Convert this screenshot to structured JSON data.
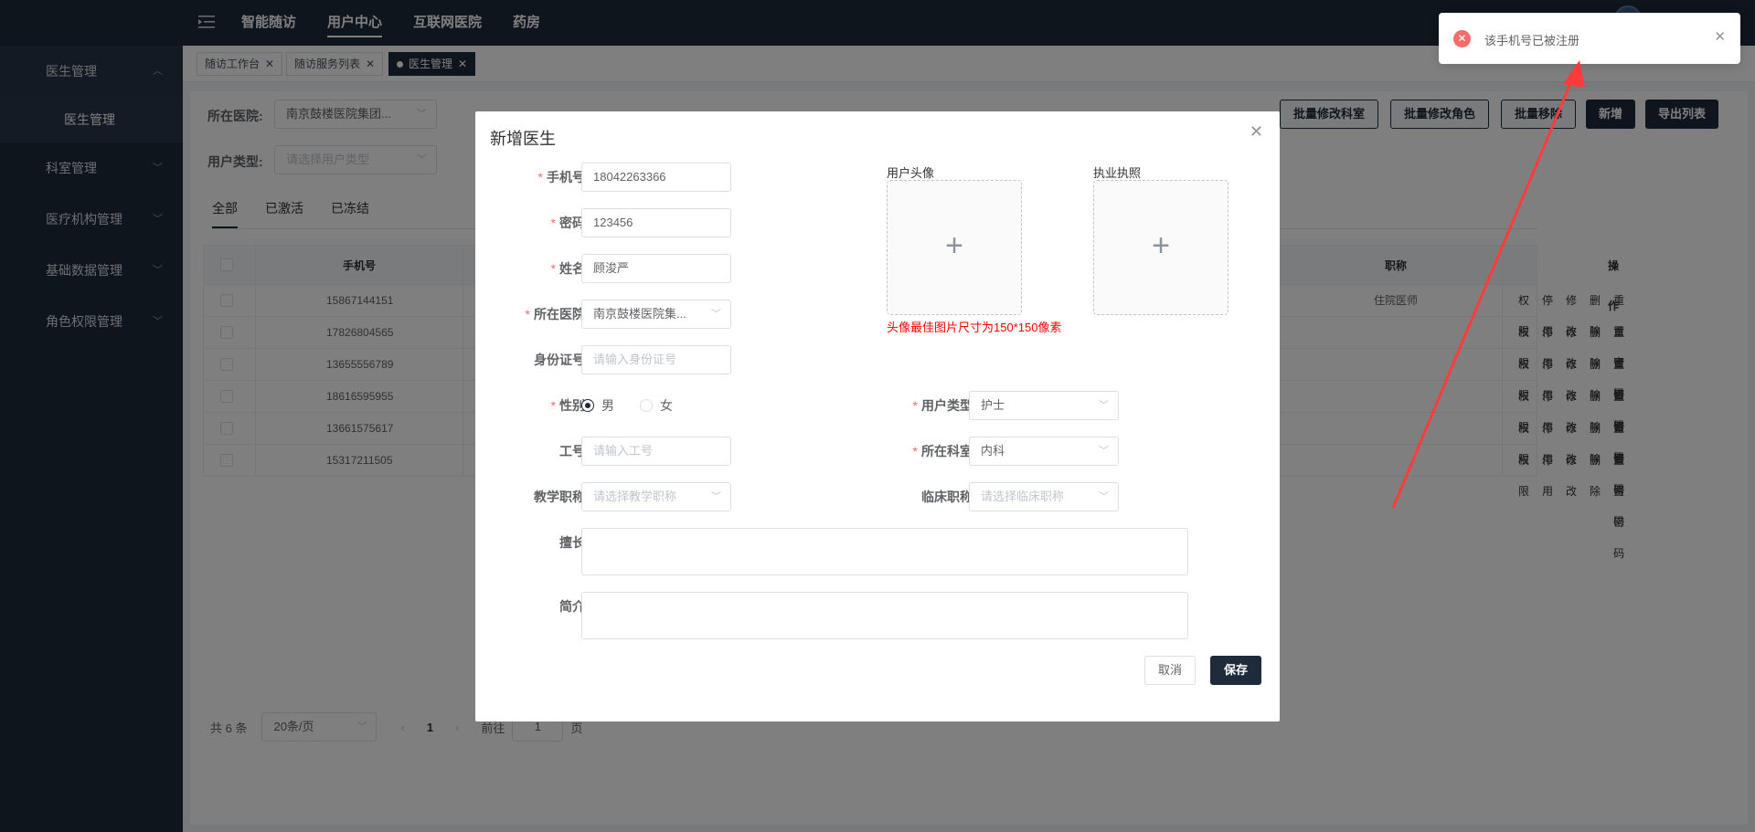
{
  "topbar": {
    "nav": [
      "智能随访",
      "用户中心",
      "互联网医院",
      "药房"
    ],
    "active_nav": "用户中心"
  },
  "sidebar": {
    "groups": [
      {
        "label": "医生管理",
        "children": [
          "医生管理"
        ],
        "open": true
      },
      {
        "label": "科室管理"
      },
      {
        "label": "医疗机构管理"
      },
      {
        "label": "基础数据管理"
      },
      {
        "label": "角色权限管理"
      }
    ]
  },
  "tagviews": [
    {
      "label": "随访工作台"
    },
    {
      "label": "随访服务列表"
    },
    {
      "label": "医生管理",
      "active": true
    }
  ],
  "filters": {
    "hospital_label": "所在医院:",
    "hospital_value": "南京鼓楼医院集团...",
    "user_type_label": "用户类型:",
    "user_type_placeholder": "请选择用户类型"
  },
  "toolbar": {
    "batch_dept": "批量修改科室",
    "batch_role": "批量修改角色",
    "batch_move": "批量移除",
    "add": "新增",
    "export": "导出列表"
  },
  "status_tabs": [
    "全部",
    "已激活",
    "已冻结"
  ],
  "table": {
    "headers": {
      "phone": "手机号",
      "title": "职称",
      "ops": "操作"
    },
    "rows": [
      {
        "phone": "15867144151",
        "title": "住院医师"
      },
      {
        "phone": "17826804565",
        "title": ""
      },
      {
        "phone": "13655556789",
        "title": ""
      },
      {
        "phone": "18616595955",
        "title": ""
      },
      {
        "phone": "13661575617",
        "title": ""
      },
      {
        "phone": "15317211505",
        "title": ""
      }
    ],
    "ops": [
      "权限",
      "停用",
      "修改",
      "删除",
      "重置密码"
    ]
  },
  "pager": {
    "total": "共 6 条",
    "page_size": "20条/页",
    "current": "1",
    "goto_label": "前往",
    "goto_value": "1",
    "page_unit": "页"
  },
  "dialog": {
    "title": "新增医生",
    "fields": {
      "phone": {
        "label": "手机号",
        "value": "18042263366"
      },
      "password": {
        "label": "密码",
        "value": "123456"
      },
      "name": {
        "label": "姓名",
        "value": "顾浚严"
      },
      "hospital": {
        "label": "所在医院",
        "value": "南京鼓楼医院集..."
      },
      "id_card": {
        "label": "身份证号",
        "placeholder": "请输入身份证号"
      },
      "gender": {
        "label": "性别",
        "options": [
          "男",
          "女"
        ],
        "selected": "男"
      },
      "job_no": {
        "label": "工号",
        "placeholder": "请输入工号"
      },
      "teaching_title": {
        "label": "教学职称",
        "placeholder": "请选择教学职称"
      },
      "user_type": {
        "label": "用户类型",
        "value": "护士"
      },
      "department": {
        "label": "所在科室",
        "value": "内科"
      },
      "clinical_title": {
        "label": "临床职称",
        "placeholder": "请选择临床职称"
      },
      "specialty": {
        "label": "擅长"
      },
      "intro": {
        "label": "简介"
      }
    },
    "avatar_label": "用户头像",
    "license_label": "执业执照",
    "avatar_tip": "头像最佳图片尺寸为150*150像素",
    "cancel": "取消",
    "save": "保存"
  },
  "toast": {
    "message": "该手机号已被注册"
  },
  "colors": {
    "nav_bg": "#1f2a3a",
    "error": "#f56c6c",
    "annotation": "#ff3b3b"
  }
}
